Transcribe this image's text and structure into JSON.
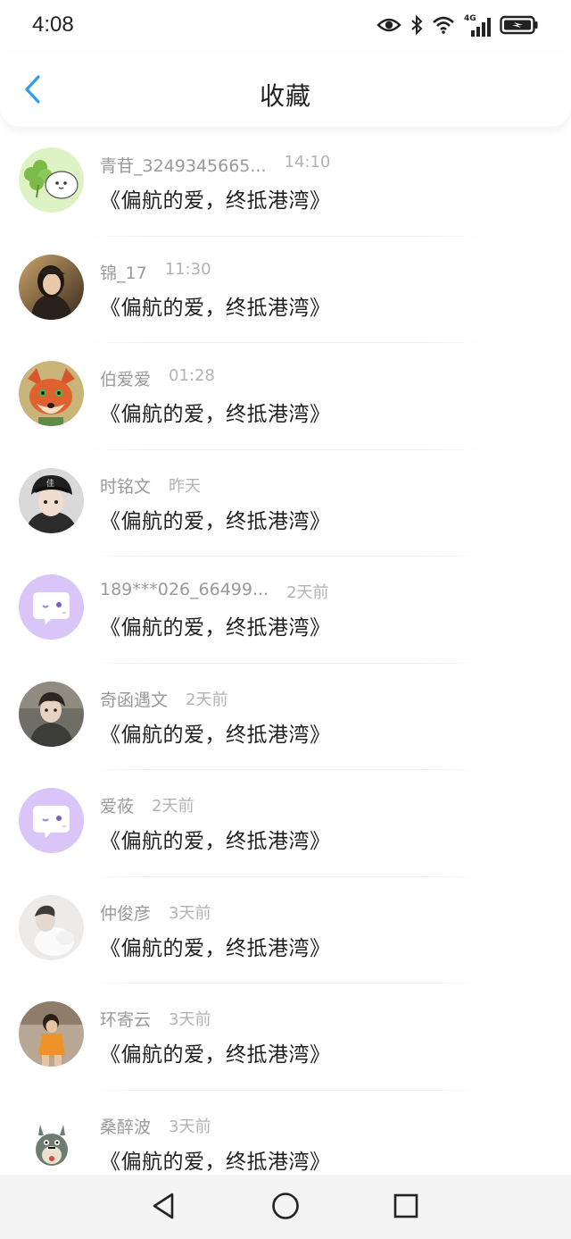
{
  "status": {
    "time": "4:08",
    "network": "4G"
  },
  "header": {
    "title": "收藏"
  },
  "items": [
    {
      "name": "青苷_3249345665...",
      "time": "14:10",
      "message": "《偏航的爱，终抵港湾》",
      "avatar": "clover-cartoon"
    },
    {
      "name": "锦_17",
      "time": "11:30",
      "message": "《偏航的爱，终抵港湾》",
      "avatar": "girl-photo"
    },
    {
      "name": "伯爱爱",
      "time": "01:28",
      "message": "《偏航的爱，终抵港湾》",
      "avatar": "fox-cartoon"
    },
    {
      "name": "时铭文",
      "time": "昨天",
      "message": "《偏航的爱，终抵港湾》",
      "avatar": "boy-cap-photo"
    },
    {
      "name": "189***026_66499...",
      "time": "2天前",
      "message": "《偏航的爱，终抵港湾》",
      "avatar": "default-chat"
    },
    {
      "name": "奇函遇文",
      "time": "2天前",
      "message": "《偏航的爱，终抵港湾》",
      "avatar": "boy-photo"
    },
    {
      "name": "爱莜",
      "time": "2天前",
      "message": "《偏航的爱，终抵港湾》",
      "avatar": "default-chat"
    },
    {
      "name": "仲俊彦",
      "time": "3天前",
      "message": "《偏航的爱，终抵港湾》",
      "avatar": "pale-photo"
    },
    {
      "name": "环寄云",
      "time": "3天前",
      "message": "《偏航的爱，终抵港湾》",
      "avatar": "child-photo"
    },
    {
      "name": "桑醉波",
      "time": "3天前",
      "message": "《偏航的爱，终抵港湾》",
      "avatar": "totoro-cartoon"
    }
  ],
  "colors": {
    "accent": "#2f9bf0",
    "default_avatar": "#d9c5f7"
  }
}
